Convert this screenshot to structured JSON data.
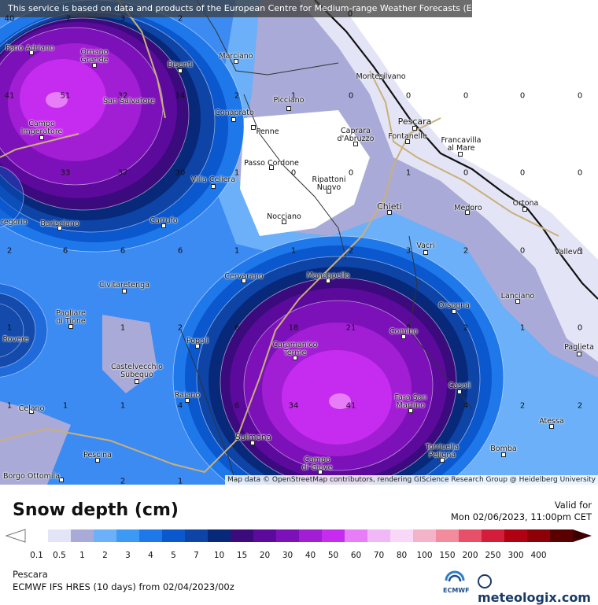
{
  "header": {
    "disclaimer": "This service is based on data and products of the European Centre for Medium-range Weather Forecasts (ECMWF)"
  },
  "map": {
    "attribution": "Map data © OpenStreetMap contributors, rendering GIScience Research Group @ Heidelberg University",
    "places": [
      {
        "name": "Montesilvano"
      },
      {
        "name": "Fano Adriano"
      },
      {
        "name": "Ornano\nGrande"
      },
      {
        "name": "Bisenti"
      },
      {
        "name": "Marciano"
      },
      {
        "name": "San Salvatore"
      },
      {
        "name": "Picciano"
      },
      {
        "name": "Pescara"
      },
      {
        "name": "Conaprato"
      },
      {
        "name": "Penne"
      },
      {
        "name": "Caprara\nd'Abruzzo"
      },
      {
        "name": "Fontanelle"
      },
      {
        "name": "Francavilla\nal Mare"
      },
      {
        "name": "Campo\nImperatore"
      },
      {
        "name": "Passo Cordone"
      },
      {
        "name": "Villa Celiera"
      },
      {
        "name": "Ripattoni\nNuovo"
      },
      {
        "name": "Chieti"
      },
      {
        "name": "Medoro"
      },
      {
        "name": "Ortona"
      },
      {
        "name": "Nocciano"
      },
      {
        "name": "regorio"
      },
      {
        "name": "Barisciano"
      },
      {
        "name": "Carrufo"
      },
      {
        "name": "Vacri"
      },
      {
        "name": "Vallevo"
      },
      {
        "name": "Cervarano"
      },
      {
        "name": "Manoppello"
      },
      {
        "name": "Civitaretenga"
      },
      {
        "name": "Lanciano"
      },
      {
        "name": "Orsogna"
      },
      {
        "name": "Pagliare\ndi Tione"
      },
      {
        "name": "Rovere"
      },
      {
        "name": "Popoli"
      },
      {
        "name": "Caramanico\nTerme"
      },
      {
        "name": "Comino"
      },
      {
        "name": "Paglieta"
      },
      {
        "name": "Castelvecchio\nSubequo"
      },
      {
        "name": "Casoli"
      },
      {
        "name": "Raiano"
      },
      {
        "name": "Fara San\nMartino"
      },
      {
        "name": "Celano"
      },
      {
        "name": "Atessa"
      },
      {
        "name": "Sulmona"
      },
      {
        "name": "Pescina"
      },
      {
        "name": "Torricella\nPeligna"
      },
      {
        "name": "Bomba"
      },
      {
        "name": "Campo\ndi Giove"
      },
      {
        "name": "Borgo Ottomila"
      }
    ],
    "grid_values": [
      {
        "v": "40"
      },
      {
        "v": "2"
      },
      {
        "v": "3"
      },
      {
        "v": "2"
      },
      {
        "v": "0"
      },
      {
        "v": "41"
      },
      {
        "v": "51"
      },
      {
        "v": "32"
      },
      {
        "v": "14"
      },
      {
        "v": "2"
      },
      {
        "v": "1"
      },
      {
        "v": "0"
      },
      {
        "v": "0"
      },
      {
        "v": "0"
      },
      {
        "v": "0"
      },
      {
        "v": "0"
      },
      {
        "v": "0"
      },
      {
        "v": "33"
      },
      {
        "v": "37"
      },
      {
        "v": "30"
      },
      {
        "v": "1"
      },
      {
        "v": "0"
      },
      {
        "v": "0"
      },
      {
        "v": "1"
      },
      {
        "v": "0"
      },
      {
        "v": "0"
      },
      {
        "v": "0"
      },
      {
        "v": "2"
      },
      {
        "v": "6"
      },
      {
        "v": "6"
      },
      {
        "v": "6"
      },
      {
        "v": "1"
      },
      {
        "v": "1"
      },
      {
        "v": "2"
      },
      {
        "v": "3"
      },
      {
        "v": "2"
      },
      {
        "v": "0"
      },
      {
        "v": "0"
      },
      {
        "v": "1"
      },
      {
        "v": "1"
      },
      {
        "v": "2"
      },
      {
        "v": "6"
      },
      {
        "v": "18"
      },
      {
        "v": "21"
      },
      {
        "v": "6"
      },
      {
        "v": "2"
      },
      {
        "v": "1"
      },
      {
        "v": "0"
      },
      {
        "v": "1"
      },
      {
        "v": "1"
      },
      {
        "v": "1"
      },
      {
        "v": "4"
      },
      {
        "v": "6"
      },
      {
        "v": "34"
      },
      {
        "v": "41"
      },
      {
        "v": "4"
      },
      {
        "v": "2"
      },
      {
        "v": "2"
      },
      {
        "v": "1"
      },
      {
        "v": "2"
      }
    ]
  },
  "footer": {
    "title": "Snow depth (cm)",
    "valid_label": "Valid for",
    "valid_time": "Mon 02/06/2023, 11:00pm CET",
    "location": "Pescara",
    "model": "ECMWF IFS HRES (10 days) from 02/04/2023/00z",
    "ecmwf_label": "ECMWF",
    "brand": "meteologix.com"
  },
  "legend": {
    "labels": [
      "0.1",
      "0.5",
      "1",
      "2",
      "3",
      "4",
      "5",
      "7",
      "10",
      "15",
      "20",
      "30",
      "40",
      "50",
      "60",
      "70",
      "80",
      "100",
      "150",
      "200",
      "250",
      "300",
      "400"
    ],
    "colors": [
      "#ffffff",
      "#e4e4f7",
      "#aaaad8",
      "#6bb0f8",
      "#3c9af5",
      "#1f78ea",
      "#0b57cd",
      "#0d44a6",
      "#08297a",
      "#3b0a7d",
      "#5b0a9b",
      "#7d11b9",
      "#a21ed4",
      "#c62cf0",
      "#e77ef7",
      "#f0b8f7",
      "#f9d7f7",
      "#f5b3c9",
      "#f28c9c",
      "#e8506a",
      "#d41c3b",
      "#b10012",
      "#8e0008",
      "#5a0000"
    ]
  }
}
